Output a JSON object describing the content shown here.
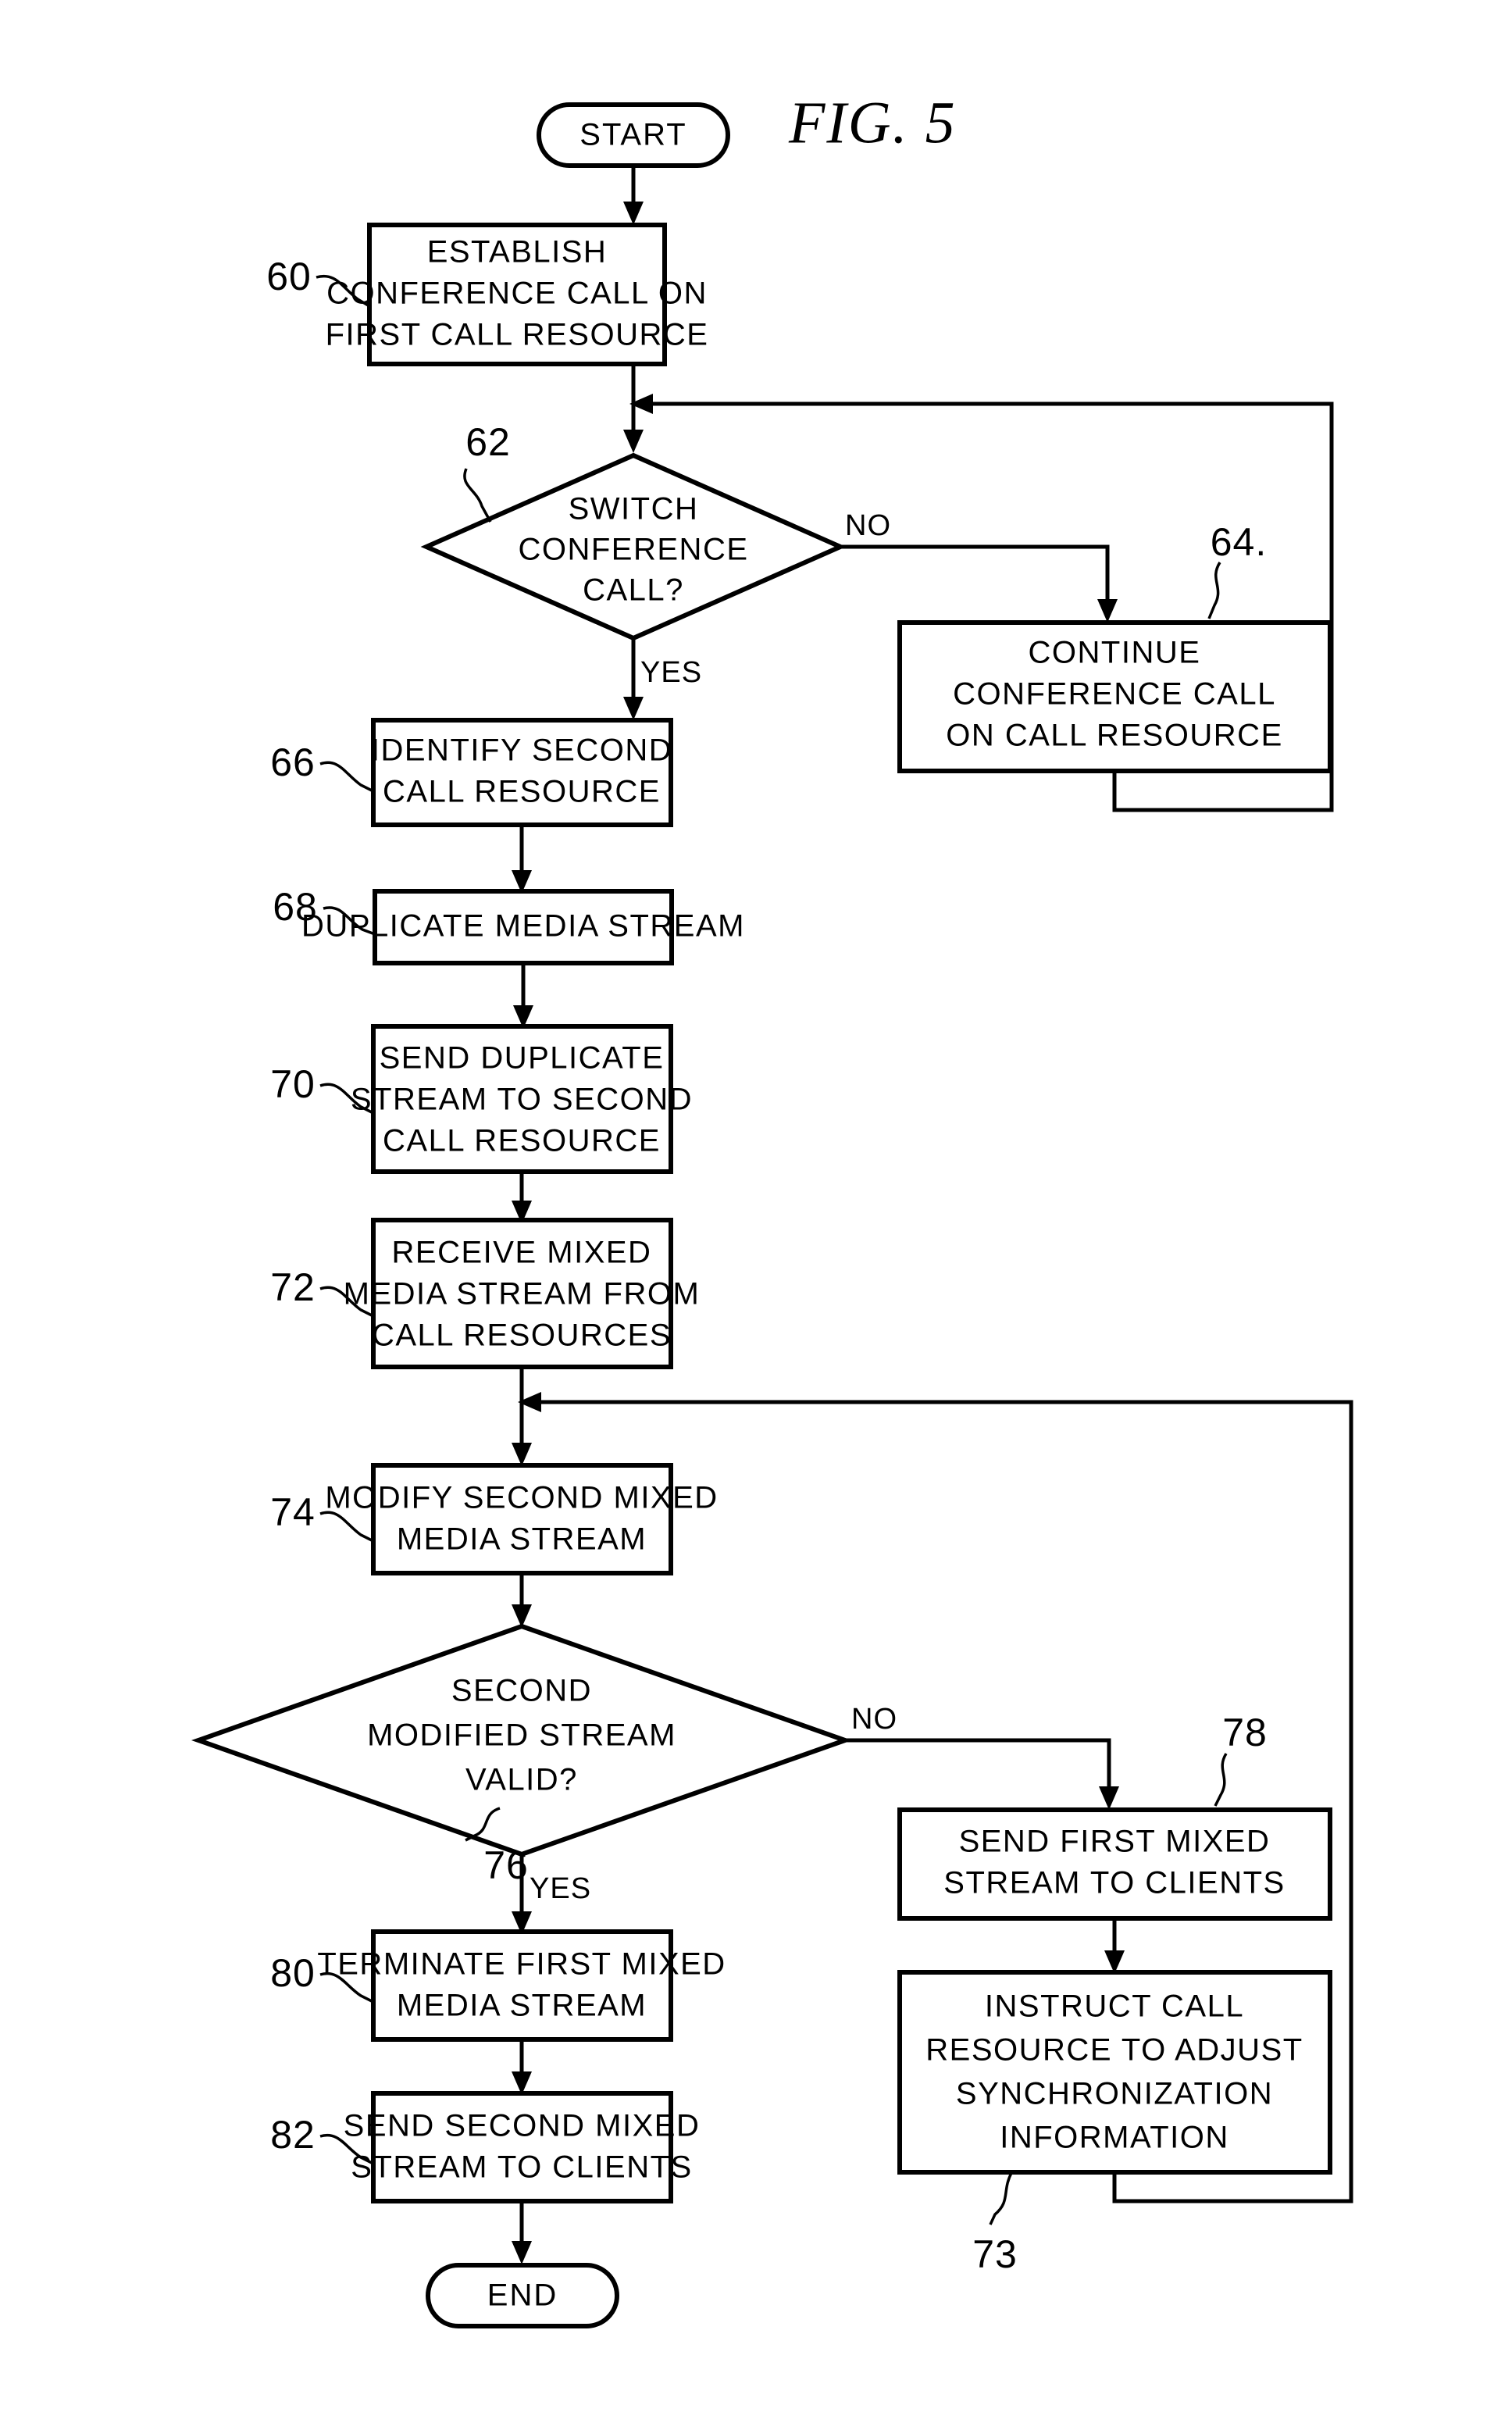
{
  "figure": {
    "title": "FIG.  5",
    "kind": "patent-flowchart"
  },
  "terminals": {
    "start": "START",
    "end": "END"
  },
  "branch_labels": {
    "d62_no": "NO",
    "d62_yes": "YES",
    "d76_no": "NO",
    "d76_yes": "YES"
  },
  "reference_numerals": {
    "n60": "60",
    "n62": "62",
    "n64": "64.",
    "n66": "66",
    "n68": "68",
    "n70": "70",
    "n72": "72",
    "n73": "73",
    "n74": "74",
    "n76": "76",
    "n78": "78",
    "n80": "80",
    "n82": "82"
  },
  "nodes": {
    "box60": {
      "ref": "60",
      "lines": [
        "ESTABLISH",
        "CONFERENCE CALL ON",
        "FIRST CALL RESOURCE"
      ]
    },
    "diamond62": {
      "ref": "62",
      "lines": [
        "SWITCH",
        "CONFERENCE",
        "CALL?"
      ]
    },
    "box64": {
      "ref": "64.",
      "lines": [
        "CONTINUE",
        "CONFERENCE CALL",
        "ON CALL RESOURCE"
      ]
    },
    "box66": {
      "ref": "66",
      "lines": [
        "IDENTIFY SECOND",
        "CALL RESOURCE"
      ]
    },
    "box68": {
      "ref": "68",
      "lines": [
        "DUPLICATE MEDIA STREAM"
      ]
    },
    "box70": {
      "ref": "70",
      "lines": [
        "SEND DUPLICATE",
        "STREAM TO SECOND",
        "CALL RESOURCE"
      ]
    },
    "box72": {
      "ref": "72",
      "lines": [
        "RECEIVE MIXED",
        "MEDIA STREAM FROM",
        "CALL RESOURCES"
      ]
    },
    "box74": {
      "ref": "74",
      "lines": [
        "MODIFY SECOND MIXED",
        "MEDIA STREAM"
      ]
    },
    "diamond76": {
      "ref": "76",
      "lines": [
        "SECOND",
        "MODIFIED STREAM",
        "VALID?"
      ]
    },
    "box78": {
      "ref": "78",
      "lines": [
        "SEND FIRST MIXED",
        "STREAM TO CLIENTS"
      ]
    },
    "box73": {
      "ref": "73",
      "lines": [
        "INSTRUCT CALL",
        "RESOURCE TO ADJUST",
        "SYNCHRONIZATION",
        "INFORMATION"
      ]
    },
    "box80": {
      "ref": "80",
      "lines": [
        "TERMINATE FIRST MIXED",
        "MEDIA STREAM"
      ]
    },
    "box82": {
      "ref": "82",
      "lines": [
        "SEND SECOND MIXED",
        "STREAM TO CLIENTS"
      ]
    }
  },
  "colors": {
    "ink": "#000000",
    "paper": "#ffffff"
  }
}
